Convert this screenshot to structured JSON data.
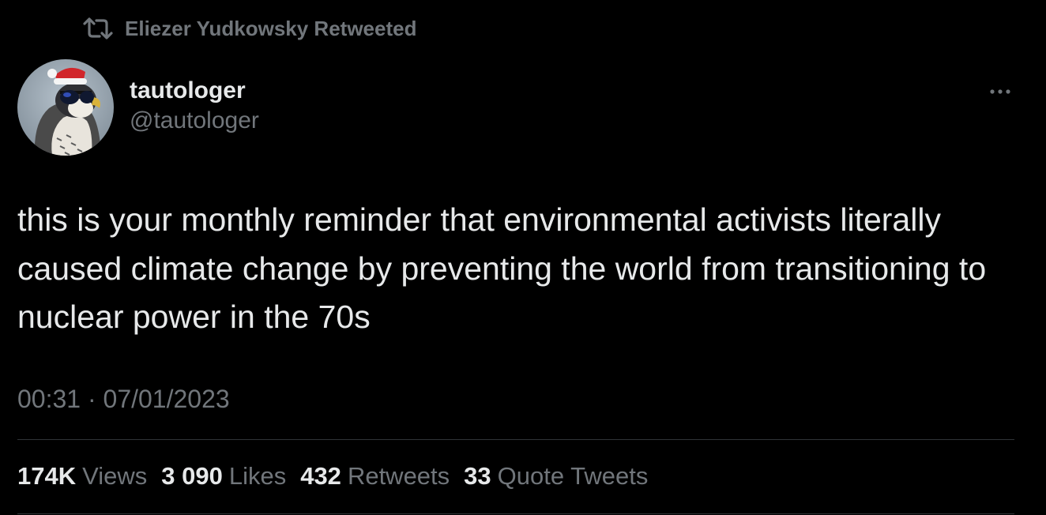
{
  "retweet_banner": {
    "icon": "retweet-icon",
    "text": "Eliezer Yudkowsky Retweeted"
  },
  "author": {
    "display_name": "tautologer",
    "handle": "@tautologer",
    "avatar_icon": "falcon-with-santa-hat-and-sunglasses"
  },
  "more_menu_icon": "more-horizontal-icon",
  "tweet": {
    "text": "this is your monthly reminder that environmental activists literally caused climate change by preventing the world from transitioning to nuclear power in the 70s",
    "time": "00:31",
    "separator": "·",
    "date": "07/01/2023"
  },
  "stats": [
    {
      "value": "174K",
      "label": "Views"
    },
    {
      "value": "3 090",
      "label": "Likes"
    },
    {
      "value": "432",
      "label": "Retweets"
    },
    {
      "value": "33",
      "label": "Quote Tweets"
    }
  ],
  "colors": {
    "background": "#000000",
    "primary_text": "#e7e9ea",
    "secondary_text": "#71767b",
    "divider": "#2f3336"
  }
}
